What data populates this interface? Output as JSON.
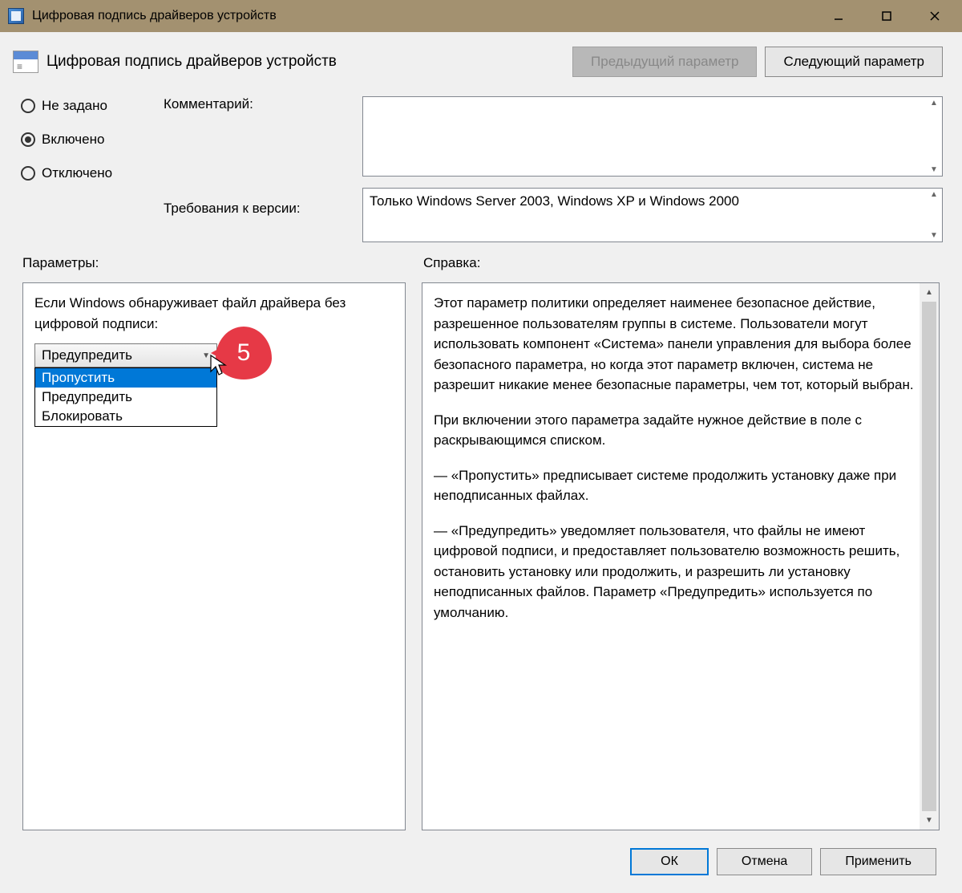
{
  "titlebar": {
    "text": "Цифровая подпись драйверов устройств"
  },
  "header": {
    "title": "Цифровая подпись драйверов устройств",
    "prev_btn": "Предыдущий параметр",
    "next_btn": "Следующий параметр"
  },
  "radios": {
    "not_set": "Не задано",
    "enabled": "Включено",
    "disabled": "Отключено"
  },
  "labels": {
    "comment": "Комментарий:",
    "version_req": "Требования к версии:",
    "parameters": "Параметры:",
    "help": "Справка:"
  },
  "version_text": "Только Windows Server 2003, Windows XP и Windows 2000",
  "param_panel": {
    "prompt": "Если Windows обнаруживает файл драйвера без цифровой подписи:",
    "selected": "Предупредить",
    "options": [
      "Пропустить",
      "Предупредить",
      "Блокировать"
    ]
  },
  "callout_number": "5",
  "help_text": {
    "p1": "Этот параметр политики определяет наименее безопасное действие, разрешенное пользователям группы в системе. Пользователи могут использовать компонент «Система» панели управления для выбора более безопасного параметра, но когда этот параметр включен, система не разрешит никакие менее безопасные параметры, чем тот, который выбран.",
    "p2": "При включении этого параметра задайте нужное действие в поле с раскрывающимся списком.",
    "p3": "— «Пропустить» предписывает системе продолжить установку даже при неподписанных файлах.",
    "p4": "— «Предупредить» уведомляет пользователя, что файлы не имеют цифровой подписи, и предоставляет пользователю возможность решить, остановить установку или продолжить, и разрешить ли установку неподписанных файлов. Параметр «Предупредить» используется по умолчанию."
  },
  "footer": {
    "ok": "ОК",
    "cancel": "Отмена",
    "apply": "Применить"
  }
}
